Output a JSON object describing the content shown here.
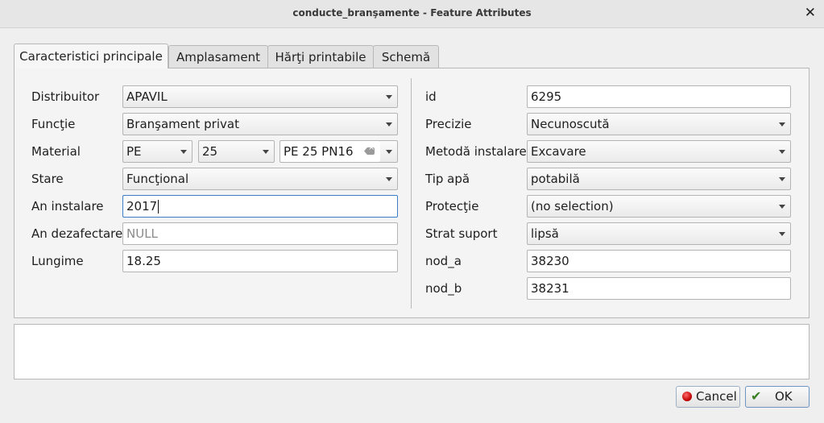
{
  "window": {
    "title": "conducte_branşamente - Feature Attributes",
    "close_glyph": "✕"
  },
  "tabs": [
    "Caracteristici principale",
    "Amplasament",
    "Hărţi printabile",
    "Schemă"
  ],
  "left": {
    "distribuitor": {
      "label": "Distribuitor",
      "value": "APAVIL"
    },
    "functie": {
      "label": "Funcţie",
      "value": "Branşament privat"
    },
    "material": {
      "label": "Material",
      "type": "PE",
      "diameter": "25",
      "spec": "PE 25 PN16"
    },
    "stare": {
      "label": "Stare",
      "value": "Funcţional"
    },
    "an_instalare": {
      "label": "An instalare",
      "value": "2017"
    },
    "an_dezafectare": {
      "label": "An dezafectare",
      "value": "NULL"
    },
    "lungime": {
      "label": "Lungime",
      "value": "18.25"
    }
  },
  "right": {
    "id": {
      "label": "id",
      "value": "6295"
    },
    "precizie": {
      "label": "Precizie",
      "value": "Necunoscută"
    },
    "metoda": {
      "label": "Metodă instalare",
      "value": "Excavare"
    },
    "tip_apa": {
      "label": "Tip apă",
      "value": "potabilă"
    },
    "protectie": {
      "label": "Protecţie",
      "value": "(no selection)"
    },
    "strat": {
      "label": "Strat suport",
      "value": "lipsă"
    },
    "nod_a": {
      "label": "nod_a",
      "value": "38230"
    },
    "nod_b": {
      "label": "nod_b",
      "value": "38231"
    }
  },
  "buttons": {
    "cancel": "Cancel",
    "ok": "OK"
  }
}
